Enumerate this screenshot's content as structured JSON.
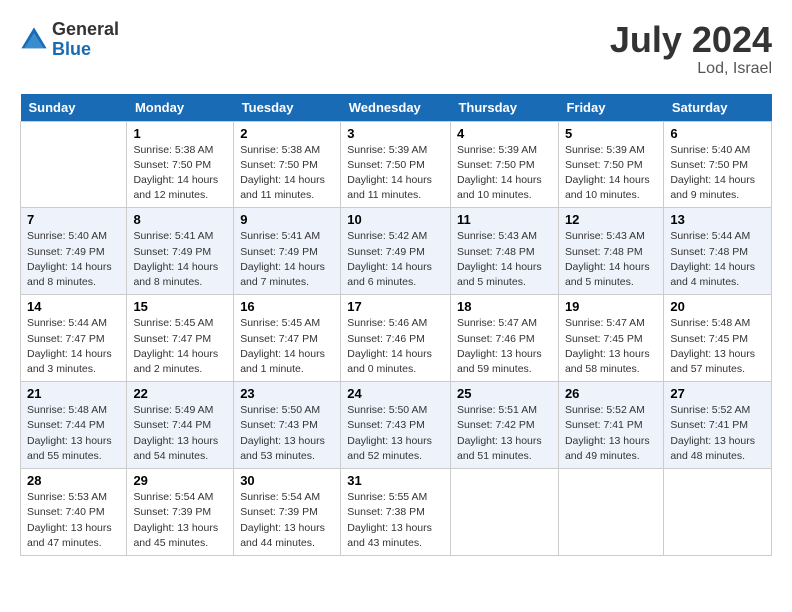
{
  "header": {
    "logo_general": "General",
    "logo_blue": "Blue",
    "month_title": "July 2024",
    "location": "Lod, Israel"
  },
  "weekdays": [
    "Sunday",
    "Monday",
    "Tuesday",
    "Wednesday",
    "Thursday",
    "Friday",
    "Saturday"
  ],
  "weeks": [
    [
      {
        "day": "",
        "info": ""
      },
      {
        "day": "1",
        "info": "Sunrise: 5:38 AM\nSunset: 7:50 PM\nDaylight: 14 hours\nand 12 minutes."
      },
      {
        "day": "2",
        "info": "Sunrise: 5:38 AM\nSunset: 7:50 PM\nDaylight: 14 hours\nand 11 minutes."
      },
      {
        "day": "3",
        "info": "Sunrise: 5:39 AM\nSunset: 7:50 PM\nDaylight: 14 hours\nand 11 minutes."
      },
      {
        "day": "4",
        "info": "Sunrise: 5:39 AM\nSunset: 7:50 PM\nDaylight: 14 hours\nand 10 minutes."
      },
      {
        "day": "5",
        "info": "Sunrise: 5:39 AM\nSunset: 7:50 PM\nDaylight: 14 hours\nand 10 minutes."
      },
      {
        "day": "6",
        "info": "Sunrise: 5:40 AM\nSunset: 7:50 PM\nDaylight: 14 hours\nand 9 minutes."
      }
    ],
    [
      {
        "day": "7",
        "info": "Sunrise: 5:40 AM\nSunset: 7:49 PM\nDaylight: 14 hours\nand 8 minutes."
      },
      {
        "day": "8",
        "info": "Sunrise: 5:41 AM\nSunset: 7:49 PM\nDaylight: 14 hours\nand 8 minutes."
      },
      {
        "day": "9",
        "info": "Sunrise: 5:41 AM\nSunset: 7:49 PM\nDaylight: 14 hours\nand 7 minutes."
      },
      {
        "day": "10",
        "info": "Sunrise: 5:42 AM\nSunset: 7:49 PM\nDaylight: 14 hours\nand 6 minutes."
      },
      {
        "day": "11",
        "info": "Sunrise: 5:43 AM\nSunset: 7:48 PM\nDaylight: 14 hours\nand 5 minutes."
      },
      {
        "day": "12",
        "info": "Sunrise: 5:43 AM\nSunset: 7:48 PM\nDaylight: 14 hours\nand 5 minutes."
      },
      {
        "day": "13",
        "info": "Sunrise: 5:44 AM\nSunset: 7:48 PM\nDaylight: 14 hours\nand 4 minutes."
      }
    ],
    [
      {
        "day": "14",
        "info": "Sunrise: 5:44 AM\nSunset: 7:47 PM\nDaylight: 14 hours\nand 3 minutes."
      },
      {
        "day": "15",
        "info": "Sunrise: 5:45 AM\nSunset: 7:47 PM\nDaylight: 14 hours\nand 2 minutes."
      },
      {
        "day": "16",
        "info": "Sunrise: 5:45 AM\nSunset: 7:47 PM\nDaylight: 14 hours\nand 1 minute."
      },
      {
        "day": "17",
        "info": "Sunrise: 5:46 AM\nSunset: 7:46 PM\nDaylight: 14 hours\nand 0 minutes."
      },
      {
        "day": "18",
        "info": "Sunrise: 5:47 AM\nSunset: 7:46 PM\nDaylight: 13 hours\nand 59 minutes."
      },
      {
        "day": "19",
        "info": "Sunrise: 5:47 AM\nSunset: 7:45 PM\nDaylight: 13 hours\nand 58 minutes."
      },
      {
        "day": "20",
        "info": "Sunrise: 5:48 AM\nSunset: 7:45 PM\nDaylight: 13 hours\nand 57 minutes."
      }
    ],
    [
      {
        "day": "21",
        "info": "Sunrise: 5:48 AM\nSunset: 7:44 PM\nDaylight: 13 hours\nand 55 minutes."
      },
      {
        "day": "22",
        "info": "Sunrise: 5:49 AM\nSunset: 7:44 PM\nDaylight: 13 hours\nand 54 minutes."
      },
      {
        "day": "23",
        "info": "Sunrise: 5:50 AM\nSunset: 7:43 PM\nDaylight: 13 hours\nand 53 minutes."
      },
      {
        "day": "24",
        "info": "Sunrise: 5:50 AM\nSunset: 7:43 PM\nDaylight: 13 hours\nand 52 minutes."
      },
      {
        "day": "25",
        "info": "Sunrise: 5:51 AM\nSunset: 7:42 PM\nDaylight: 13 hours\nand 51 minutes."
      },
      {
        "day": "26",
        "info": "Sunrise: 5:52 AM\nSunset: 7:41 PM\nDaylight: 13 hours\nand 49 minutes."
      },
      {
        "day": "27",
        "info": "Sunrise: 5:52 AM\nSunset: 7:41 PM\nDaylight: 13 hours\nand 48 minutes."
      }
    ],
    [
      {
        "day": "28",
        "info": "Sunrise: 5:53 AM\nSunset: 7:40 PM\nDaylight: 13 hours\nand 47 minutes."
      },
      {
        "day": "29",
        "info": "Sunrise: 5:54 AM\nSunset: 7:39 PM\nDaylight: 13 hours\nand 45 minutes."
      },
      {
        "day": "30",
        "info": "Sunrise: 5:54 AM\nSunset: 7:39 PM\nDaylight: 13 hours\nand 44 minutes."
      },
      {
        "day": "31",
        "info": "Sunrise: 5:55 AM\nSunset: 7:38 PM\nDaylight: 13 hours\nand 43 minutes."
      },
      {
        "day": "",
        "info": ""
      },
      {
        "day": "",
        "info": ""
      },
      {
        "day": "",
        "info": ""
      }
    ]
  ]
}
